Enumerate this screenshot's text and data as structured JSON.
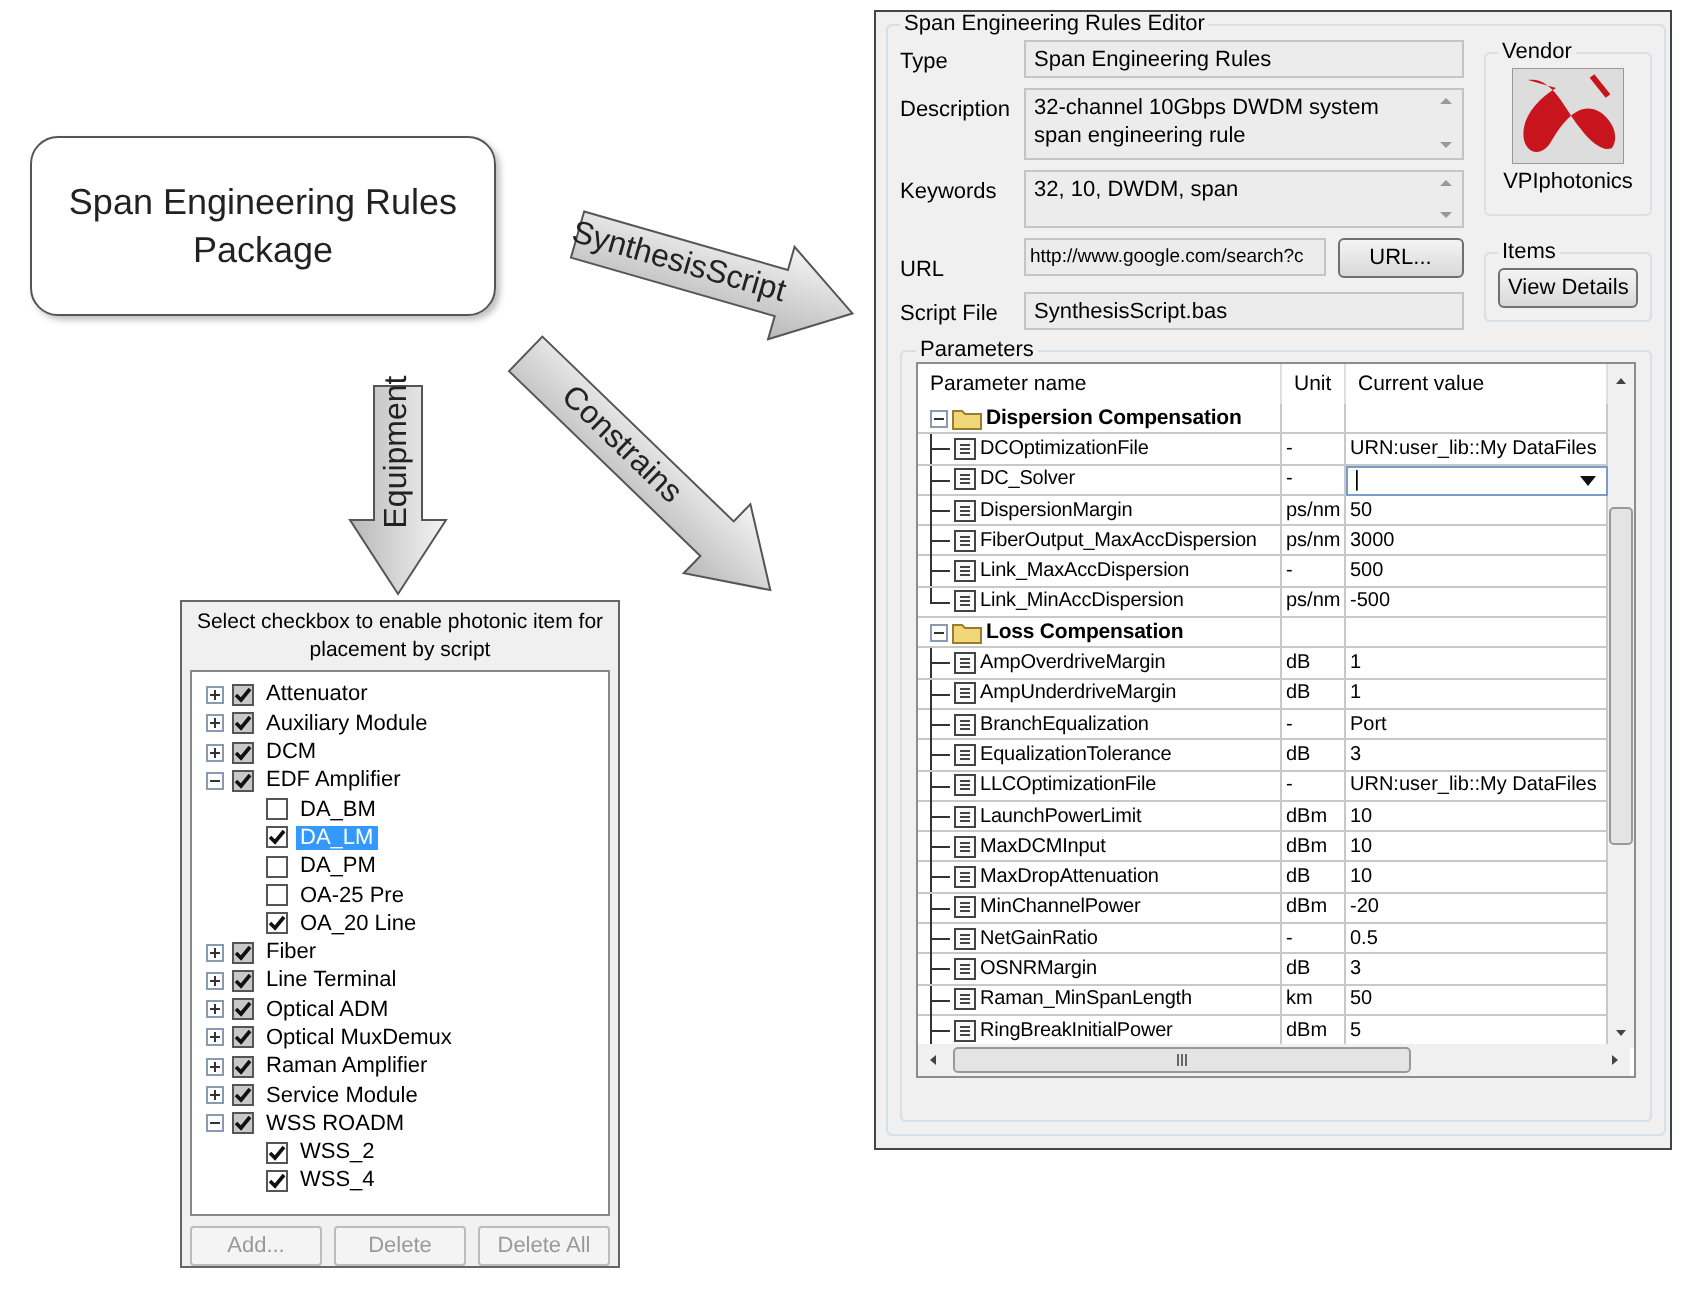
{
  "package": {
    "title": "Span Engineering Rules Package"
  },
  "arrows": [
    {
      "label": "SynthesisScript"
    },
    {
      "label": "Equipment"
    },
    {
      "label": "Constrains"
    }
  ],
  "equipment_panel": {
    "header": "Select checkbox to enable photonic item for placement by script",
    "tree": [
      {
        "label": "Attenuator",
        "checked": true,
        "expanded": false,
        "selected": false
      },
      {
        "label": "Auxiliary Module",
        "checked": true,
        "expanded": false,
        "selected": false
      },
      {
        "label": "DCM",
        "checked": true,
        "expanded": false,
        "selected": false
      },
      {
        "label": "EDF Amplifier",
        "checked": true,
        "expanded": true,
        "selected": false,
        "children": [
          {
            "label": "DA_BM",
            "checked": false,
            "selected": false
          },
          {
            "label": "DA_LM",
            "checked": true,
            "selected": true
          },
          {
            "label": "DA_PM",
            "checked": false,
            "selected": false
          },
          {
            "label": "OA-25 Pre",
            "checked": false,
            "selected": false
          },
          {
            "label": "OA_20 Line",
            "checked": true,
            "selected": false
          }
        ]
      },
      {
        "label": "Fiber",
        "checked": true,
        "expanded": false,
        "selected": false
      },
      {
        "label": "Line Terminal",
        "checked": true,
        "expanded": false,
        "selected": false
      },
      {
        "label": "Optical ADM",
        "checked": true,
        "expanded": false,
        "selected": false
      },
      {
        "label": "Optical MuxDemux",
        "checked": true,
        "expanded": false,
        "selected": false
      },
      {
        "label": "Raman Amplifier",
        "checked": true,
        "expanded": false,
        "selected": false
      },
      {
        "label": "Service Module",
        "checked": true,
        "expanded": false,
        "selected": false
      },
      {
        "label": "WSS ROADM",
        "checked": true,
        "expanded": true,
        "selected": false,
        "children": [
          {
            "label": "WSS_2",
            "checked": true,
            "selected": false
          },
          {
            "label": "WSS_4",
            "checked": true,
            "selected": false
          }
        ]
      }
    ],
    "buttons": [
      {
        "label": "Add...",
        "disabled": true
      },
      {
        "label": "Delete",
        "disabled": true
      },
      {
        "label": "Delete All",
        "disabled": true
      }
    ]
  },
  "editor": {
    "title": "Span Engineering Rules Editor",
    "fields": [
      {
        "label": "Type",
        "value": "Span Engineering Rules",
        "kind": "text"
      },
      {
        "label": "Description",
        "value": "32-channel 10Gbps DWDM system span engineering rule",
        "kind": "multiline"
      },
      {
        "label": "Keywords",
        "value": "32, 10, DWDM, span",
        "kind": "multiline"
      },
      {
        "label": "URL",
        "value": "http://www.google.com/search?c",
        "kind": "url",
        "button": "URL..."
      },
      {
        "label": "Script File",
        "value": "SynthesisScript.bas",
        "kind": "text"
      }
    ],
    "vendor": {
      "title": "Vendor",
      "name": "VPIphotonics"
    },
    "items": {
      "title": "Items",
      "button": "View Details"
    },
    "parameters": {
      "title": "Parameters",
      "columns": [
        "Parameter name",
        "Unit",
        "Current value"
      ],
      "groups": [
        {
          "name": "Dispersion Compensation",
          "expanded": true,
          "rows": [
            {
              "name": "DCOptimizationFile",
              "unit": "-",
              "value": "URN:user_lib::My DataFiles",
              "kind": "text"
            },
            {
              "name": "DC_Solver",
              "unit": "-",
              "value": "|",
              "kind": "dropdown"
            },
            {
              "name": "DispersionMargin",
              "unit": "ps/nm",
              "value": "50",
              "kind": "text"
            },
            {
              "name": "FiberOutput_MaxAccDispersion",
              "unit": "ps/nm",
              "value": "3000",
              "kind": "text"
            },
            {
              "name": "Link_MaxAccDispersion",
              "unit": "-",
              "value": "500",
              "kind": "text"
            },
            {
              "name": "Link_MinAccDispersion",
              "unit": "ps/nm",
              "value": "-500",
              "kind": "text"
            }
          ]
        },
        {
          "name": "Loss Compensation",
          "expanded": true,
          "rows": [
            {
              "name": "AmpOverdriveMargin",
              "unit": "dB",
              "value": "1",
              "kind": "text"
            },
            {
              "name": "AmpUnderdriveMargin",
              "unit": "dB",
              "value": "1",
              "kind": "text"
            },
            {
              "name": "BranchEqualization",
              "unit": "-",
              "value": "Port",
              "kind": "text"
            },
            {
              "name": "EqualizationTolerance",
              "unit": "dB",
              "value": "3",
              "kind": "text"
            },
            {
              "name": "LLCOptimizationFile",
              "unit": "-",
              "value": "URN:user_lib::My DataFiles",
              "kind": "text"
            },
            {
              "name": "LaunchPowerLimit",
              "unit": "dBm",
              "value": "10",
              "kind": "text"
            },
            {
              "name": "MaxDCMInput",
              "unit": "dBm",
              "value": "10",
              "kind": "text"
            },
            {
              "name": "MaxDropAttenuation",
              "unit": "dB",
              "value": "10",
              "kind": "text"
            },
            {
              "name": "MinChannelPower",
              "unit": "dBm",
              "value": "-20",
              "kind": "text"
            },
            {
              "name": "NetGainRatio",
              "unit": "-",
              "value": "0.5",
              "kind": "text"
            },
            {
              "name": "OSNRMargin",
              "unit": "dB",
              "value": "3",
              "kind": "text"
            },
            {
              "name": "Raman_MinSpanLength",
              "unit": "km",
              "value": "50",
              "kind": "text"
            },
            {
              "name": "RingBreakInitialPower",
              "unit": "dBm",
              "value": "5",
              "kind": "text"
            }
          ]
        }
      ]
    }
  }
}
